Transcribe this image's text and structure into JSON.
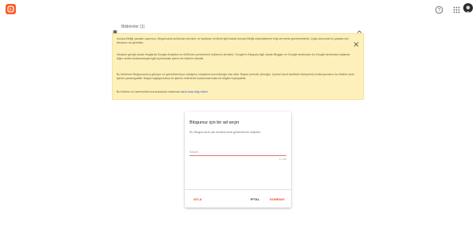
{
  "header": {
    "logo_icon": "blogger-logo-icon",
    "help_icon": "help-icon",
    "apps_icon": "apps-grid-icon",
    "avatar_icon": "user-avatar",
    "accent": "#ff5722"
  },
  "notice": {
    "title": "Bildirimler (1)",
    "colors": {
      "background": "#fdf0ba",
      "link": "#3a62c4"
    },
    "paragraph1": "Avrupa Birliği yasaları uyarınca, Blogunuzda kullanılan çerezler ve toplanan verilerle ilgili olarak Avrupa Birliği ziyaretçilerine bilgi vermeniz gerekmektedir. Çoğu durumda bu yasalar izin almanızı da gerektirir.",
    "paragraph2": "Nezaket gereği olarak bloglarda Google Analytics ve AdSense çerezlerinin kullanımı da dahil, Google'ın Bloguzla ilgili olarak Blogger ve Google tarafından bu Google tarafından toplanan diğer verileri kullanmasıyla ilgili açıklamalar içeren bir bildirim ekledik.",
    "paragraph3": "Bu bildirimin Bloğunuzda iş görüyor ve görüntülenüyor olduğunu onaylama sorumluluğu size aittir. Başka çerezler (örneğin, üçüncü taraf özellikleri ekleyerek) kullanıyorsanız bu bildirim sizin işinize yaramayabilir. Başka sağlayıcılarsa ek işlemin ekleneniz kullanıcılarından ek bilgileri toplayabilir.",
    "paragraph4_prefix": "Bu bildirim ve üzerinizdeki sorumluluklar hakkında ",
    "paragraph4_link": "daha fazla bilgi edinin."
  },
  "dialog": {
    "title": "Blogunuz için bir ad seçin",
    "description": "Bu Blogunuzun adı hesabınızda gösterilecek başlıktır.",
    "input_value": "",
    "input_placeholder": "Başlık",
    "char_count": "0 / 100",
    "skip_label": "ATLA",
    "cancel_label": "İPTAL",
    "next_label": "SONRAKİ",
    "accent": "#e64a19"
  }
}
